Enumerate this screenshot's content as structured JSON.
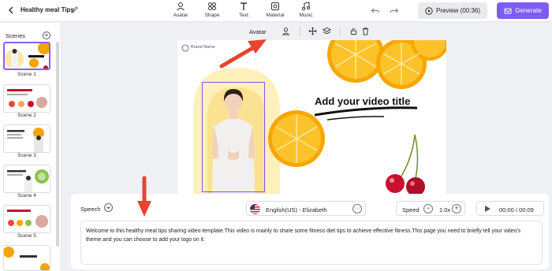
{
  "header": {
    "title": "Healthy meal Tips",
    "tools": [
      {
        "label": "Avatar",
        "icon": "avatar-icon"
      },
      {
        "label": "Shape",
        "icon": "shape-icon"
      },
      {
        "label": "Text",
        "icon": "text-icon"
      },
      {
        "label": "Material",
        "icon": "material-icon"
      },
      {
        "label": "Music",
        "icon": "music-icon"
      }
    ],
    "preview_label": "Preview (00:36)",
    "generate_label": "Generate",
    "accent_color": "#7d5cf6"
  },
  "sidebar": {
    "title": "Scenes",
    "scenes": [
      {
        "label": "Scene 1",
        "active": true
      },
      {
        "label": "Scene 2",
        "active": false
      },
      {
        "label": "Scene 3",
        "active": false
      },
      {
        "label": "Scene 4",
        "active": false
      },
      {
        "label": "Scene 5",
        "active": false
      }
    ]
  },
  "context_toolbar": {
    "label": "Avatar"
  },
  "canvas": {
    "brand": "Brand Name",
    "video_title": "Add your video title"
  },
  "speech_panel": {
    "label": "Speech",
    "voice": "English(US) - Elizabeth",
    "speed_label": "Speed",
    "speed_value": "1.0x",
    "time": "00:00 / 00:09",
    "script": "Welcome to this healthy meal tips sharing video template.This video is mainly to share some fitness diet tips to achieve effective fitness.This page you need to briefly tell your video's theme and you can choose to add your logo on it."
  }
}
